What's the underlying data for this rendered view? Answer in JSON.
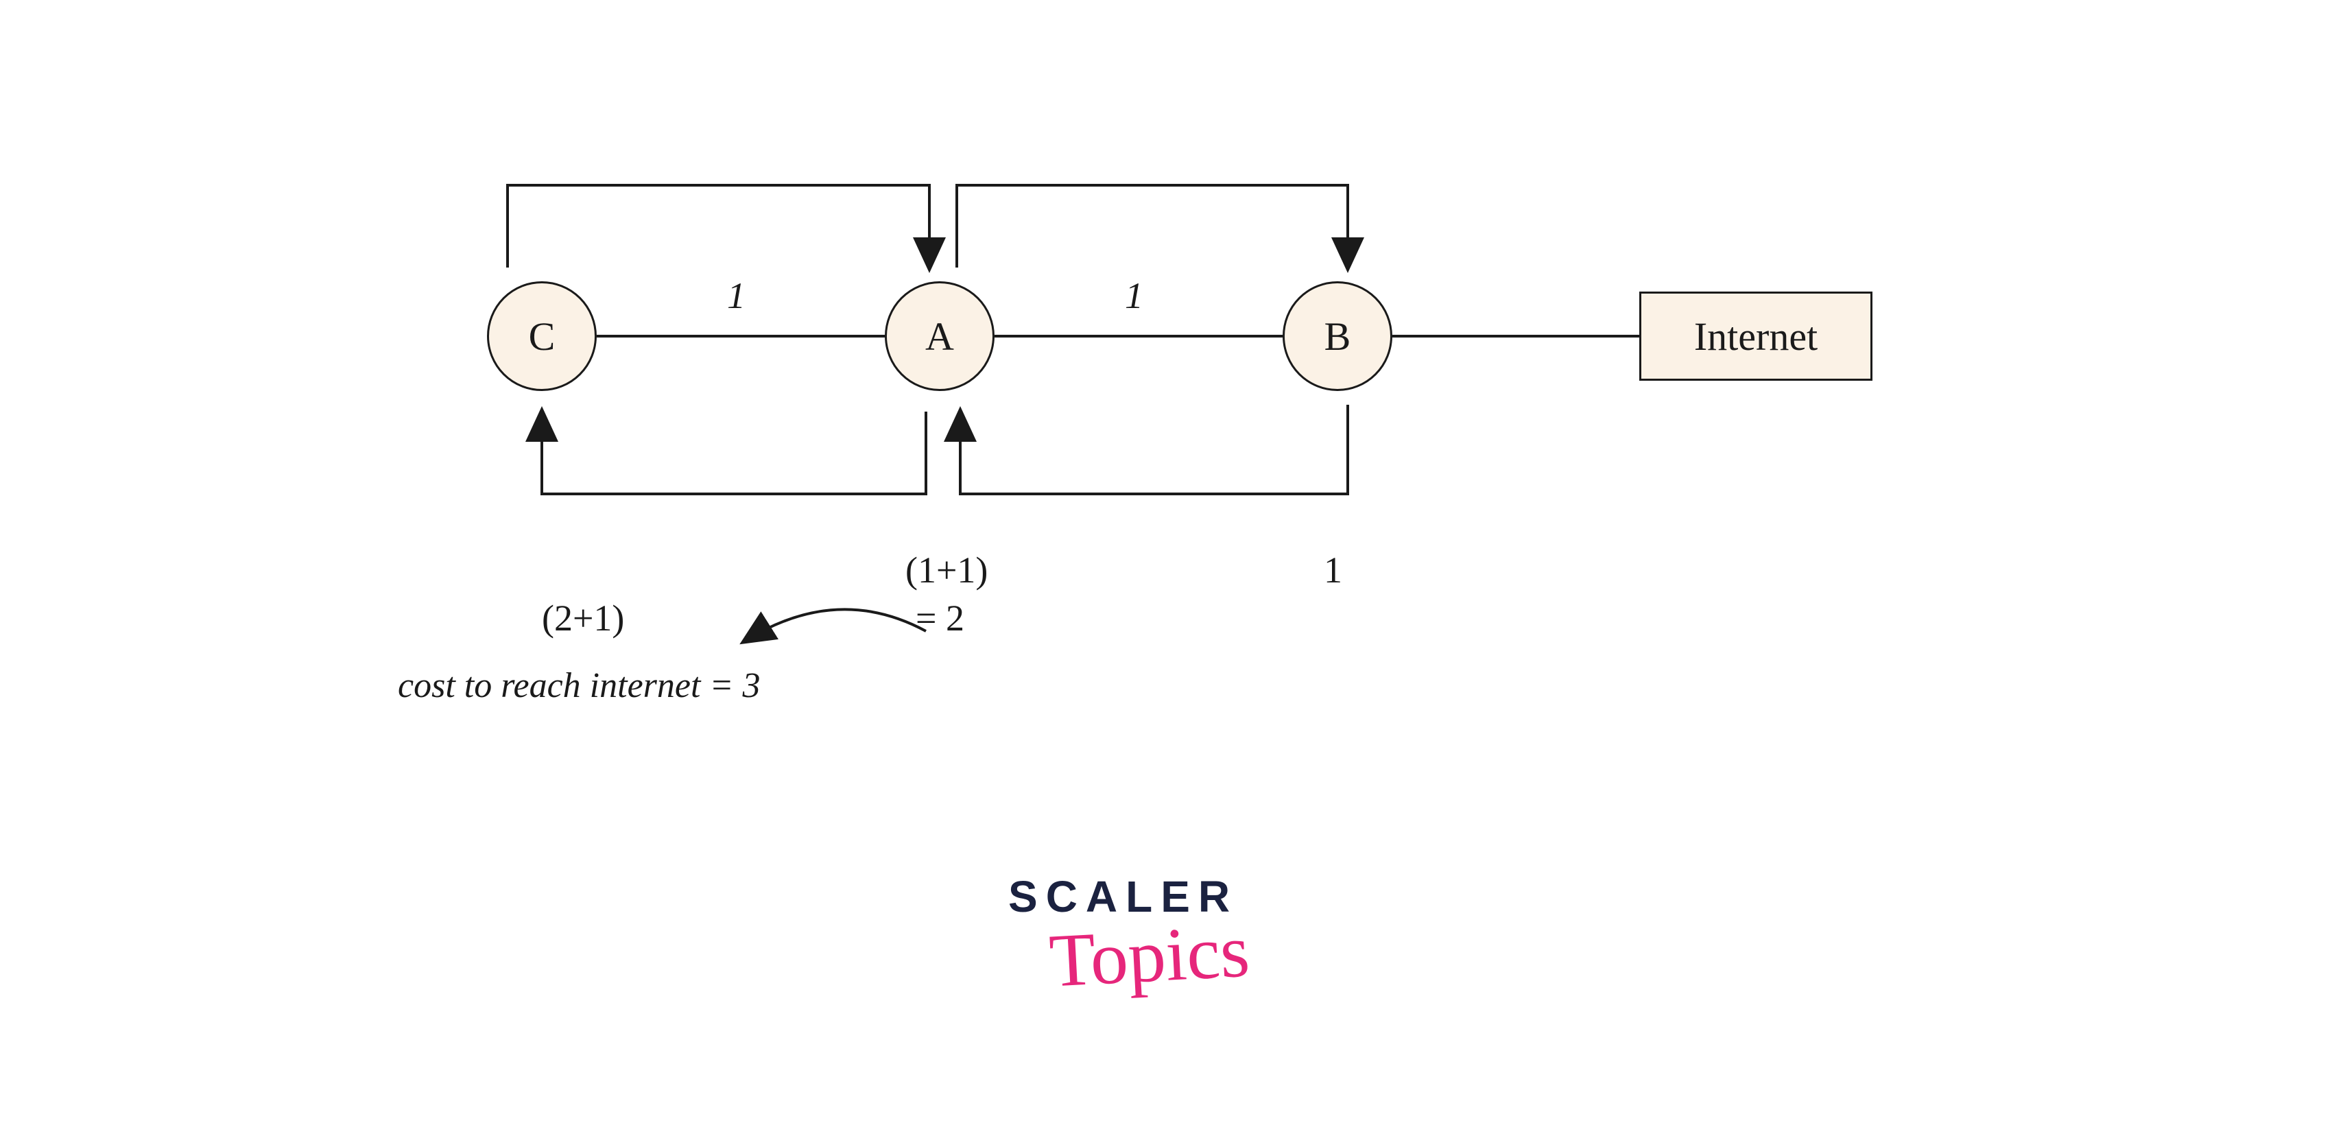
{
  "nodes": {
    "c": "C",
    "a": "A",
    "b": "B",
    "internet": "Internet"
  },
  "edgeLabels": {
    "ca": "1",
    "ab": "1"
  },
  "annotations": {
    "b_cost": "1",
    "a_cost_line1": "(1+1)",
    "a_cost_line2": "= 2",
    "c_cost_line1": "(2+1)",
    "c_explanation": "cost to reach internet = 3"
  },
  "logo": {
    "scaler": "SCALER",
    "topics": "Topics"
  },
  "diagram": {
    "description": "Network routing cost diagram. Three circular nodes C, A, B connected in a line, with B connected to a rectangular Internet box. Edge weights of 1 between C-A and A-B. Top arrows show C→A and A→B direction. Bottom arrows show B→A and B→C direction with accumulated costs: B has cost 1, A has cost (1+1)=2, C has cost (2+1) and cost to reach internet = 3."
  }
}
